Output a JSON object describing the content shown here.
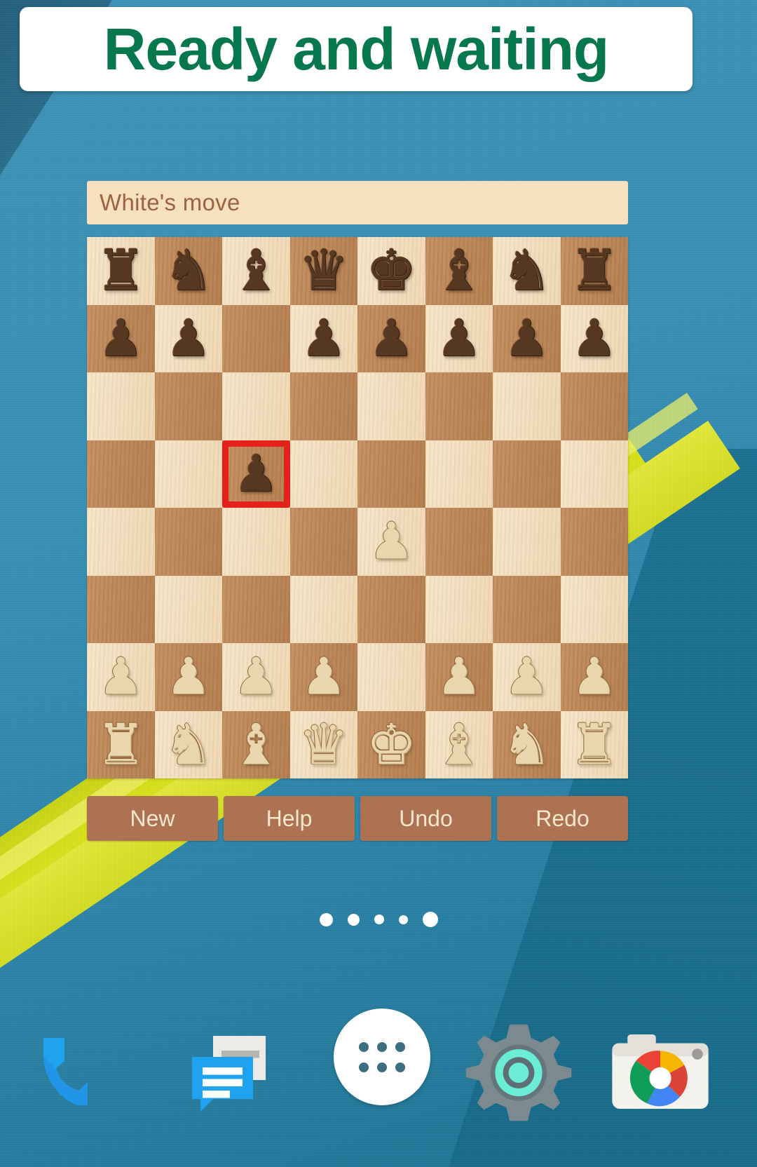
{
  "header": {
    "title": "Ready and waiting",
    "title_color": "#07774E",
    "background_color": "#FFFFFF"
  },
  "wallpaper": {
    "base_color": "#3A90B4",
    "dark_color": "#1F7493",
    "stripe_color": "#D4DC24"
  },
  "app": {
    "status": {
      "text": "White's move",
      "background_color": "#F7E0C0",
      "text_color": "#9A6341"
    },
    "board": {
      "light_square_color": "#F2DFC0",
      "dark_square_color": "#BE8A5C",
      "selection_color": "#E4211A",
      "selected_square": "c5",
      "files": [
        "a",
        "b",
        "c",
        "d",
        "e",
        "f",
        "g",
        "h"
      ],
      "ranks": [
        8,
        7,
        6,
        5,
        4,
        3,
        2,
        1
      ],
      "ranks_pieces": [
        [
          {
            "square": "a8",
            "piece": "rook",
            "color": "black",
            "glyph": "♜"
          },
          {
            "square": "b8",
            "piece": "knight",
            "color": "black",
            "glyph": "♞"
          },
          {
            "square": "c8",
            "piece": "bishop",
            "color": "black",
            "glyph": "♝"
          },
          {
            "square": "d8",
            "piece": "queen",
            "color": "black",
            "glyph": "♛"
          },
          {
            "square": "e8",
            "piece": "king",
            "color": "black",
            "glyph": "♚"
          },
          {
            "square": "f8",
            "piece": "bishop",
            "color": "black",
            "glyph": "♝"
          },
          {
            "square": "g8",
            "piece": "knight",
            "color": "black",
            "glyph": "♞"
          },
          {
            "square": "h8",
            "piece": "rook",
            "color": "black",
            "glyph": "♜"
          }
        ],
        [
          {
            "square": "a7",
            "piece": "pawn",
            "color": "black",
            "glyph": "♟"
          },
          {
            "square": "b7",
            "piece": "pawn",
            "color": "black",
            "glyph": "♟"
          },
          {
            "square": "c7",
            "piece": null,
            "color": null,
            "glyph": ""
          },
          {
            "square": "d7",
            "piece": "pawn",
            "color": "black",
            "glyph": "♟"
          },
          {
            "square": "e7",
            "piece": "pawn",
            "color": "black",
            "glyph": "♟"
          },
          {
            "square": "f7",
            "piece": "pawn",
            "color": "black",
            "glyph": "♟"
          },
          {
            "square": "g7",
            "piece": "pawn",
            "color": "black",
            "glyph": "♟"
          },
          {
            "square": "h7",
            "piece": "pawn",
            "color": "black",
            "glyph": "♟"
          }
        ],
        [
          {
            "square": "a6",
            "piece": null,
            "color": null,
            "glyph": ""
          },
          {
            "square": "b6",
            "piece": null,
            "color": null,
            "glyph": ""
          },
          {
            "square": "c6",
            "piece": null,
            "color": null,
            "glyph": ""
          },
          {
            "square": "d6",
            "piece": null,
            "color": null,
            "glyph": ""
          },
          {
            "square": "e6",
            "piece": null,
            "color": null,
            "glyph": ""
          },
          {
            "square": "f6",
            "piece": null,
            "color": null,
            "glyph": ""
          },
          {
            "square": "g6",
            "piece": null,
            "color": null,
            "glyph": ""
          },
          {
            "square": "h6",
            "piece": null,
            "color": null,
            "glyph": ""
          }
        ],
        [
          {
            "square": "a5",
            "piece": null,
            "color": null,
            "glyph": ""
          },
          {
            "square": "b5",
            "piece": null,
            "color": null,
            "glyph": ""
          },
          {
            "square": "c5",
            "piece": "pawn",
            "color": "black",
            "glyph": "♟",
            "selected": true
          },
          {
            "square": "d5",
            "piece": null,
            "color": null,
            "glyph": ""
          },
          {
            "square": "e5",
            "piece": null,
            "color": null,
            "glyph": ""
          },
          {
            "square": "f5",
            "piece": null,
            "color": null,
            "glyph": ""
          },
          {
            "square": "g5",
            "piece": null,
            "color": null,
            "glyph": ""
          },
          {
            "square": "h5",
            "piece": null,
            "color": null,
            "glyph": ""
          }
        ],
        [
          {
            "square": "a4",
            "piece": null,
            "color": null,
            "glyph": ""
          },
          {
            "square": "b4",
            "piece": null,
            "color": null,
            "glyph": ""
          },
          {
            "square": "c4",
            "piece": null,
            "color": null,
            "glyph": ""
          },
          {
            "square": "d4",
            "piece": null,
            "color": null,
            "glyph": ""
          },
          {
            "square": "e4",
            "piece": "pawn",
            "color": "white",
            "glyph": "♟"
          },
          {
            "square": "f4",
            "piece": null,
            "color": null,
            "glyph": ""
          },
          {
            "square": "g4",
            "piece": null,
            "color": null,
            "glyph": ""
          },
          {
            "square": "h4",
            "piece": null,
            "color": null,
            "glyph": ""
          }
        ],
        [
          {
            "square": "a3",
            "piece": null,
            "color": null,
            "glyph": ""
          },
          {
            "square": "b3",
            "piece": null,
            "color": null,
            "glyph": ""
          },
          {
            "square": "c3",
            "piece": null,
            "color": null,
            "glyph": ""
          },
          {
            "square": "d3",
            "piece": null,
            "color": null,
            "glyph": ""
          },
          {
            "square": "e3",
            "piece": null,
            "color": null,
            "glyph": ""
          },
          {
            "square": "f3",
            "piece": null,
            "color": null,
            "glyph": ""
          },
          {
            "square": "g3",
            "piece": null,
            "color": null,
            "glyph": ""
          },
          {
            "square": "h3",
            "piece": null,
            "color": null,
            "glyph": ""
          }
        ],
        [
          {
            "square": "a2",
            "piece": "pawn",
            "color": "white",
            "glyph": "♟"
          },
          {
            "square": "b2",
            "piece": "pawn",
            "color": "white",
            "glyph": "♟"
          },
          {
            "square": "c2",
            "piece": "pawn",
            "color": "white",
            "glyph": "♟"
          },
          {
            "square": "d2",
            "piece": "pawn",
            "color": "white",
            "glyph": "♟"
          },
          {
            "square": "e2",
            "piece": null,
            "color": null,
            "glyph": ""
          },
          {
            "square": "f2",
            "piece": "pawn",
            "color": "white",
            "glyph": "♟"
          },
          {
            "square": "g2",
            "piece": "pawn",
            "color": "white",
            "glyph": "♟"
          },
          {
            "square": "h2",
            "piece": "pawn",
            "color": "white",
            "glyph": "♟"
          }
        ],
        [
          {
            "square": "a1",
            "piece": "rook",
            "color": "white",
            "glyph": "♜"
          },
          {
            "square": "b1",
            "piece": "knight",
            "color": "white",
            "glyph": "♞"
          },
          {
            "square": "c1",
            "piece": "bishop",
            "color": "white",
            "glyph": "♝"
          },
          {
            "square": "d1",
            "piece": "queen",
            "color": "white",
            "glyph": "♛"
          },
          {
            "square": "e1",
            "piece": "king",
            "color": "white",
            "glyph": "♚"
          },
          {
            "square": "f1",
            "piece": "bishop",
            "color": "white",
            "glyph": "♝"
          },
          {
            "square": "g1",
            "piece": "knight",
            "color": "white",
            "glyph": "♞"
          },
          {
            "square": "h1",
            "piece": "rook",
            "color": "white",
            "glyph": "♜"
          }
        ]
      ]
    },
    "controls": {
      "background_color": "#AC7252",
      "text_color": "#F6E6CE",
      "buttons": [
        {
          "label": "New"
        },
        {
          "label": "Help"
        },
        {
          "label": "Undo"
        },
        {
          "label": "Redo"
        }
      ]
    }
  },
  "home_screen": {
    "page_dots": {
      "count": 5,
      "color": "#FFFFFF"
    },
    "dock": [
      {
        "name": "phone-icon",
        "label": "Phone"
      },
      {
        "name": "messaging-icon",
        "label": "Messaging"
      },
      {
        "name": "app-drawer-icon",
        "label": "Apps"
      },
      {
        "name": "settings-icon",
        "label": "Settings"
      },
      {
        "name": "camera-icon",
        "label": "Camera"
      }
    ]
  }
}
